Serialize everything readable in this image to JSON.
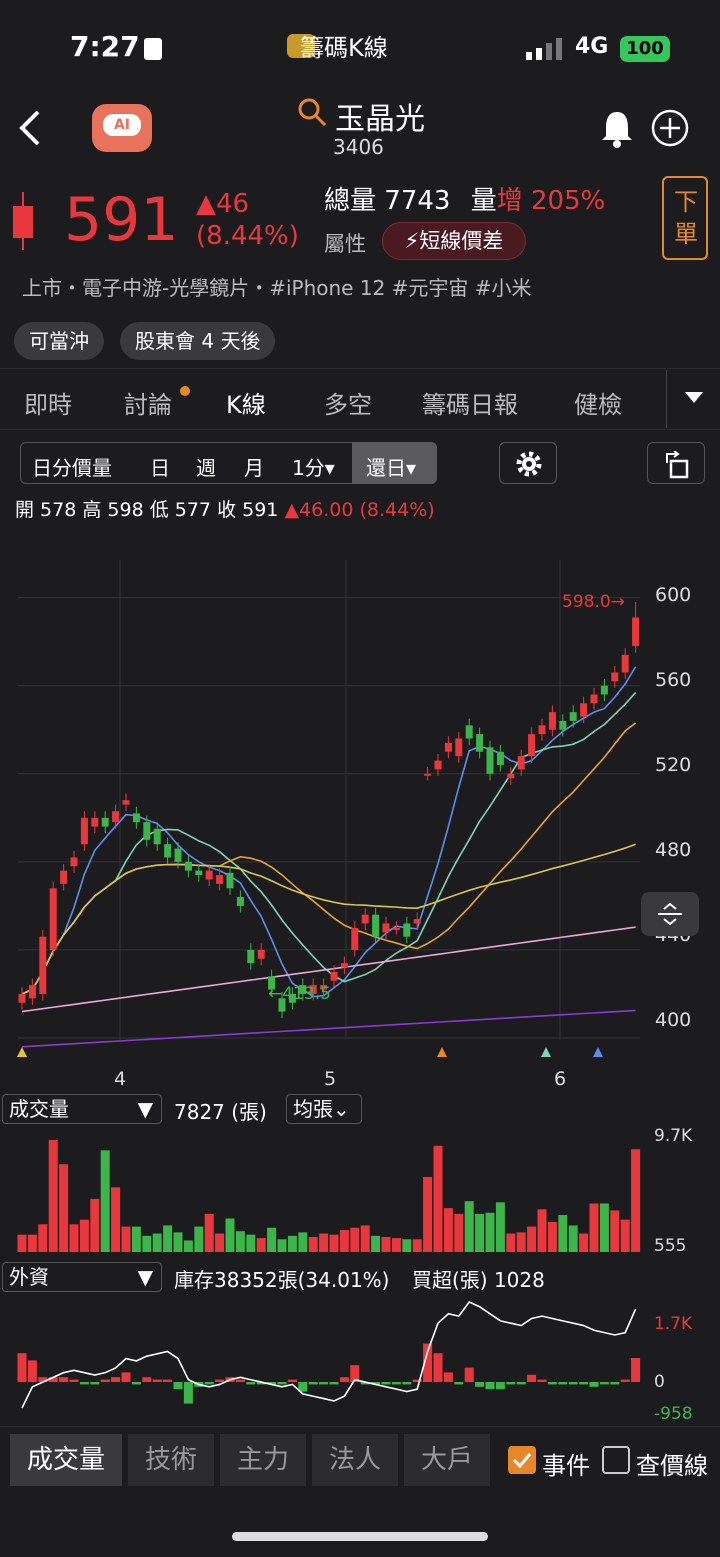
{
  "status_bar": {
    "time": "7:27",
    "app_name": "籌碼K線",
    "network": "4G",
    "battery": "100"
  },
  "stock": {
    "name": "玉晶光",
    "code": "3406",
    "price": "591",
    "change": "▲46",
    "change_pct": "(8.44%)",
    "total_volume_label": "總量",
    "total_volume": "7743",
    "volume_label": "量",
    "volume_trend": "增",
    "volume_trend_pct": "205%",
    "attr_label": "屬性",
    "attr_badge": "短線價差",
    "order_button": "下單",
    "tags": "上市・電子中游-光學鏡片・#iPhone 12 #元宇宙 #小米"
  },
  "chips": [
    "可當沖",
    "股東會 4 天後"
  ],
  "tabs": [
    "即時",
    "討論",
    "K線",
    "多空",
    "籌碼日報",
    "健檢"
  ],
  "active_tab": "K線",
  "period_selector": [
    "日分價量",
    "日",
    "週",
    "月",
    "1分▾",
    "還日▾"
  ],
  "ohlc": {
    "open": "開 578",
    "high": "高 598",
    "low": "低 577",
    "close": "收 591",
    "chg": "▲46.00 (8.44%)"
  },
  "chart": {
    "price_axis": [
      "600",
      "560",
      "520",
      "480",
      "440",
      "400"
    ],
    "date_axis": [
      "4",
      "5",
      "6"
    ],
    "high_marker": "598.0→",
    "low_marker": "←413.5"
  },
  "chart_data": {
    "type": "candlestick",
    "open": [
      416,
      418,
      420,
      440,
      470,
      478,
      488,
      496,
      500,
      498,
      506,
      502,
      498,
      495,
      488,
      486,
      480,
      476,
      472,
      470,
      475,
      464,
      440,
      436,
      428,
      418,
      420,
      424,
      420,
      422,
      426,
      432,
      440,
      452,
      456,
      448,
      450,
      452,
      452,
      520,
      522,
      530,
      528,
      542,
      538,
      532,
      530,
      518,
      522,
      528,
      538,
      540,
      544,
      548,
      546,
      552,
      560,
      562,
      566,
      578
    ],
    "close": [
      420,
      424,
      446,
      468,
      476,
      482,
      500,
      500,
      496,
      503,
      508,
      498,
      490,
      488,
      482,
      480,
      476,
      474,
      476,
      474,
      468,
      460,
      434,
      440,
      422,
      412,
      416,
      420,
      424,
      424,
      430,
      434,
      450,
      456,
      446,
      452,
      450,
      446,
      454,
      520,
      526,
      534,
      536,
      536,
      530,
      520,
      524,
      520,
      528,
      538,
      542,
      548,
      540,
      544,
      552,
      556,
      556,
      566,
      574,
      591
    ],
    "price_ylim": [
      390,
      608
    ],
    "volume": {
      "label": "成交量",
      "value": "7827 (張)",
      "unit_button": "均張",
      "max_label": "9.7K",
      "min_label": "555",
      "values": [
        1.5,
        1.5,
        2.4,
        9.7,
        7.6,
        2.4,
        2.8,
        4.6,
        8.8,
        5.6,
        2.2,
        2.2,
        1.4,
        1.6,
        2.3,
        1.7,
        1.0,
        2.2,
        3.3,
        1.6,
        2.9,
        1.8,
        1.5,
        1.2,
        2.1,
        1.1,
        1.4,
        1.7,
        1.3,
        1.6,
        1.5,
        1.9,
        2.1,
        2.3,
        1.4,
        1.3,
        1.2,
        1.1,
        1.1,
        6.5,
        9.2,
        3.8,
        3.3,
        4.4,
        3.3,
        3.4,
        4.3,
        1.6,
        1.7,
        2.2,
        3.7,
        2.6,
        3.2,
        2.3,
        1.6,
        4.2,
        4.2,
        3.6,
        2.8,
        8.9
      ]
    },
    "foreign": {
      "label": "外資",
      "inventory": "庫存38352張(34.01%)",
      "buy": "買超(張) 1028",
      "max_label": "1.7K",
      "zero_label": "0",
      "min_label": "-958",
      "values": [
        1.2,
        0.9,
        0.2,
        0.2,
        0.2,
        0.1,
        -0.1,
        -0.1,
        0.1,
        0.2,
        0.4,
        -0.1,
        0.2,
        0.1,
        0.1,
        -0.3,
        -0.9,
        -0.2,
        -0.1,
        0.1,
        0.2,
        0.1,
        -0.1,
        -0.1,
        -0.1,
        -0.1,
        0.1,
        -0.4,
        -0.1,
        -0.1,
        -0.1,
        0.2,
        0.7,
        -0.1,
        -0.1,
        -0.1,
        -0.1,
        -0.1,
        0.1,
        1.6,
        1.2,
        0.4,
        -0.1,
        0.6,
        -0.2,
        -0.3,
        -0.3,
        -0.1,
        -0.1,
        0.3,
        0.1,
        -0.1,
        -0.1,
        -0.1,
        -0.1,
        -0.2,
        -0.1,
        -0.1,
        0.1,
        1.0
      ]
    }
  },
  "bottom_tabs": [
    "成交量",
    "技術",
    "主力",
    "法人",
    "大戶"
  ],
  "checkboxes": [
    {
      "label": "事件",
      "checked": true
    },
    {
      "label": "查價線",
      "checked": false
    }
  ],
  "colors": {
    "up": "#e8383d",
    "down": "#3cb54a",
    "accent": "#e8872a"
  }
}
